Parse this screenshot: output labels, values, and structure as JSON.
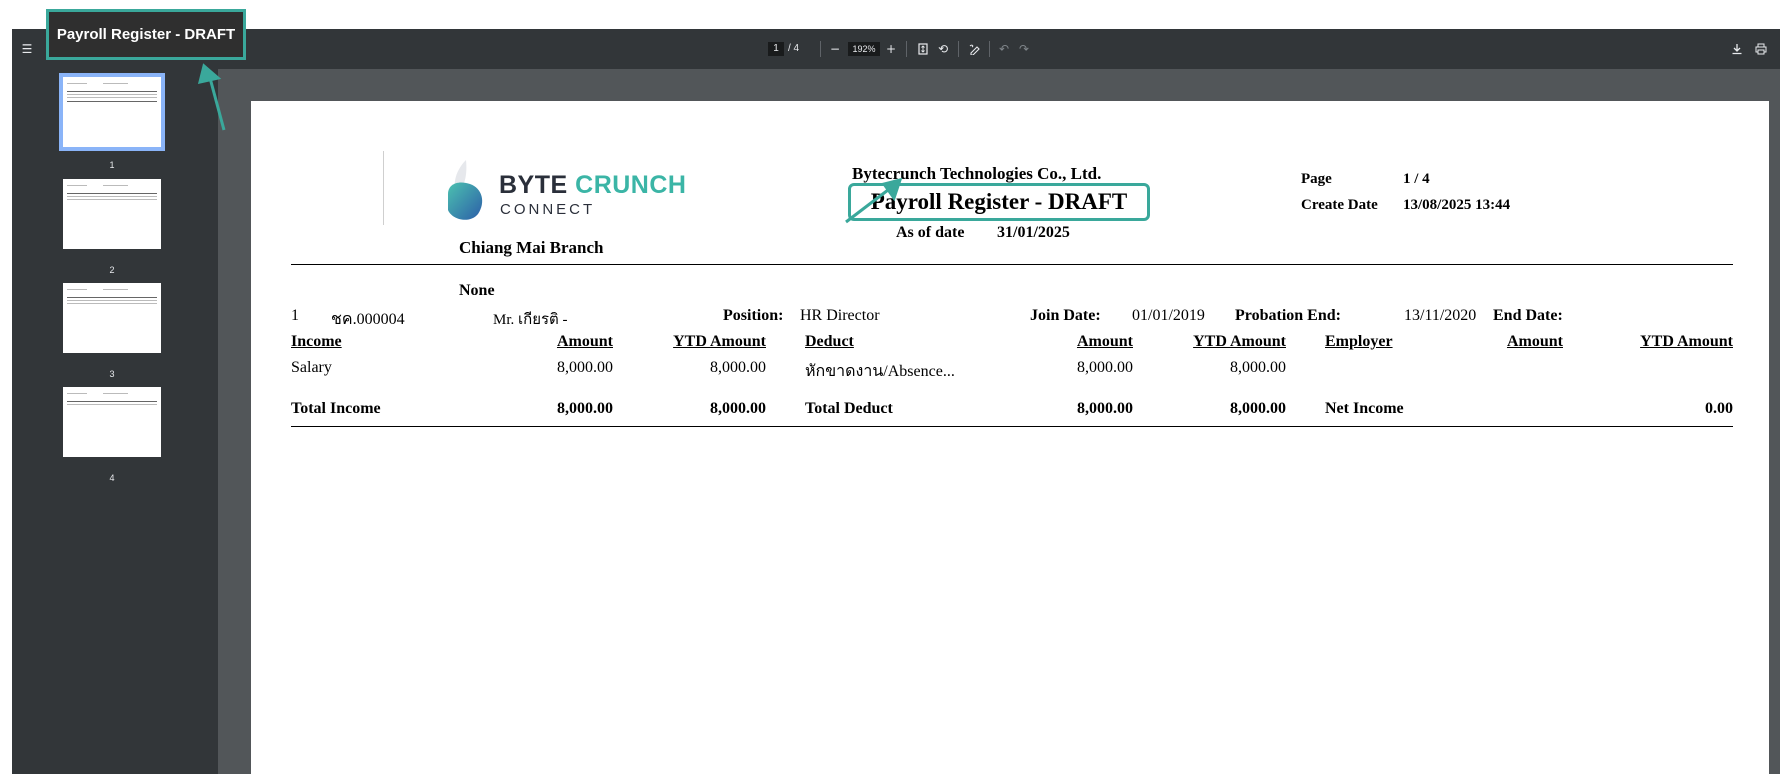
{
  "callout": {
    "label": "Payroll Register - DRAFT"
  },
  "toolbar": {
    "menu_icon": "hamburger-icon",
    "current_page": "1",
    "page_total": "/ 4",
    "zoom": "192%"
  },
  "sidebar": {
    "thumbnails": [
      {
        "label": "1"
      },
      {
        "label": "2"
      },
      {
        "label": "3"
      },
      {
        "label": "4"
      }
    ]
  },
  "document": {
    "logo": {
      "word1": "BYTE",
      "word2": "CRUNCH",
      "word3": "CONNECT"
    },
    "company": "Bytecrunch Technologies Co., Ltd.",
    "title": "Payroll Register - DRAFT",
    "as_of_label": "As of date",
    "as_of_value": "31/01/2025",
    "branch": "Chiang Mai Branch",
    "page_label": "Page",
    "page_value": "1 / 4",
    "create_date_label": "Create Date",
    "create_date_value": "13/08/2025 13:44",
    "group": "None",
    "employee": {
      "index": "1",
      "code": "ชค.000004",
      "name": "Mr. เกียรติ -",
      "position_label": "Position:",
      "position": "HR Director",
      "join_label": "Join Date:",
      "join": "01/01/2019",
      "probation_label": "Probation End:",
      "probation": "13/11/2020",
      "end_label": "End Date:"
    },
    "headers": {
      "income": "Income",
      "amount": "Amount",
      "ytd": "YTD Amount",
      "deduct": "Deduct",
      "employer": "Employer"
    },
    "row": {
      "income_name": "Salary",
      "income_amount": "8,000.00",
      "income_ytd": "8,000.00",
      "deduct_name": "หักขาดงาน/Absence...",
      "deduct_amount": "8,000.00",
      "deduct_ytd": "8,000.00"
    },
    "totals": {
      "income_label": "Total Income",
      "income_amount": "8,000.00",
      "income_ytd": "8,000.00",
      "deduct_label": "Total Deduct",
      "deduct_amount": "8,000.00",
      "deduct_ytd": "8,000.00",
      "net_label": "Net Income",
      "net_value": "0.00"
    }
  },
  "colors": {
    "accent": "#3aa89b",
    "toolbar": "#323639",
    "viewer_bg": "#525659"
  }
}
